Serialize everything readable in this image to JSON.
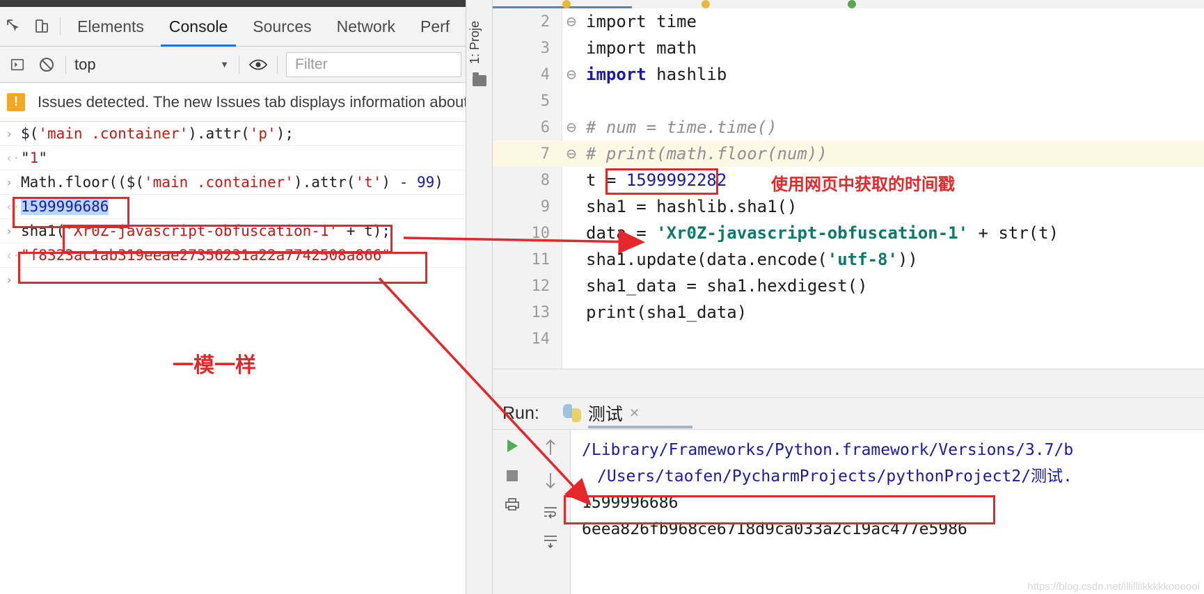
{
  "devtools": {
    "tabs": [
      {
        "label": "Elements",
        "active": false
      },
      {
        "label": "Console",
        "active": true
      },
      {
        "label": "Sources",
        "active": false
      },
      {
        "label": "Network",
        "active": false
      },
      {
        "label": "Perf",
        "active": false
      }
    ],
    "inspect_icon": "inspect-element-icon",
    "device_icon": "device-toolbar-icon",
    "execute_icon": "execute-sidebar-icon",
    "clear_icon": "clear-console-icon",
    "eye_icon": "live-expression-eye-icon",
    "context": "top",
    "caret": "▼",
    "filter_placeholder": "Filter",
    "issues": {
      "badge": "!",
      "text": "Issues detected. The new Issues tab displays information about"
    },
    "entries": [
      {
        "type": "input",
        "prompt": "›",
        "text": "$('main .container').attr('p');"
      },
      {
        "type": "output",
        "prompt": "‹·",
        "text": "\"1\""
      },
      {
        "type": "input",
        "prompt": "›",
        "text": "Math.floor(($('main .container').attr('t') - 99)"
      },
      {
        "type": "output",
        "prompt": "‹·",
        "text": "1599996686"
      },
      {
        "type": "input",
        "prompt": "›",
        "text": "sha1('Xr0Z-javascript-obfuscation-1' + t)"
      },
      {
        "type": "output",
        "prompt": "‹·",
        "text": "\"f8323ac1ab319eeae27356231a22a7742508a866\""
      },
      {
        "type": "input",
        "prompt": "›",
        "text": ""
      }
    ],
    "entry_parts": {
      "line1_a": "$(",
      "line1_b": "'main .container'",
      "line1_c": ").attr(",
      "line1_d": "'p'",
      "line1_e": ");",
      "line2_q1": "\"",
      "line2_v": "1",
      "line2_q2": "\"",
      "line3_a": "Math.floor((",
      "line3_b": "$(",
      "line3_c": "'main .container'",
      "line3_d": ").attr(",
      "line3_e": "'t'",
      "line3_f": ") ",
      "line3_g": "- 99",
      "line3_h": ")",
      "line4_v": "1599996686",
      "line5_a": "sha1(",
      "line5_b": "'Xr0Z-javascript-obfuscation-1'",
      "line5_c": " + t)",
      "line5_d": ";",
      "line6_q1": "\"",
      "line6_v": "f8323ac1ab319eeae27356231a22a7742508a866",
      "line6_q2": "\""
    },
    "annotation": "一模一样"
  },
  "pycharm": {
    "rail_label": "1: Proje",
    "folder_icon": "project-folder-icon",
    "code_lines": [
      {
        "no": "2",
        "fold": "⊖",
        "kw": "import",
        "rest": " time",
        "highlight": false,
        "style": "kw"
      },
      {
        "no": "3",
        "fold": "",
        "kw": "import",
        "rest": " math",
        "highlight": false,
        "style": "plain"
      },
      {
        "no": "4",
        "fold": "⊖",
        "kw": "import",
        "rest": " hashlib",
        "highlight": false,
        "style": "kw"
      },
      {
        "no": "5",
        "fold": "",
        "kw": "",
        "rest": "",
        "highlight": false,
        "style": "plain"
      },
      {
        "no": "6",
        "fold": "⊖",
        "kw": "",
        "rest": "# num = time.time()",
        "highlight": false,
        "style": "comment"
      },
      {
        "no": "7",
        "fold": "⊖",
        "kw": "",
        "rest": "# print(math.floor(num))",
        "highlight": true,
        "style": "comment"
      },
      {
        "no": "8",
        "fold": "",
        "kw": "",
        "rest": "",
        "highlight": false,
        "style": "line8"
      },
      {
        "no": "9",
        "fold": "",
        "kw": "",
        "rest": "sha1 = hashlib.sha1()",
        "highlight": false,
        "style": "plain"
      },
      {
        "no": "10",
        "fold": "",
        "kw": "",
        "rest": "",
        "highlight": false,
        "style": "line10"
      },
      {
        "no": "11",
        "fold": "",
        "kw": "",
        "rest": "",
        "highlight": false,
        "style": "line11"
      },
      {
        "no": "12",
        "fold": "",
        "kw": "",
        "rest": "sha1_data = sha1.hexdigest()",
        "highlight": false,
        "style": "plain"
      },
      {
        "no": "13",
        "fold": "",
        "kw": "",
        "rest": "print(sha1_data)",
        "highlight": false,
        "style": "plain"
      },
      {
        "no": "14",
        "fold": "",
        "kw": "",
        "rest": "",
        "highlight": false,
        "style": "plain"
      }
    ],
    "line8": {
      "var": "t = ",
      "value": "1599992282",
      "note": "使用网页中获取的时间戳"
    },
    "line10": {
      "a": "data = ",
      "str": "'Xr0Z-javascript-obfuscation-1'",
      "b": " + str(t)"
    },
    "line11": {
      "a": "sha1.update(data.encode(",
      "str": "'utf-8'",
      "b": "))"
    },
    "run": {
      "label": "Run:",
      "tab_name": "测试",
      "close": "×",
      "python_icon": "python-logo-icon",
      "run_icon": "run-play-icon",
      "stop_icon": "stop-square-icon",
      "up_icon": "scroll-up-arrow-icon",
      "down_icon": "scroll-down-arrow-icon",
      "print_icon": "print-icon",
      "wrap_icon": "soft-wrap-icon",
      "scrollend_icon": "scroll-to-end-icon",
      "output": [
        {
          "text": "/Library/Frameworks/Python.framework/Versions/3.7/b",
          "indent": false,
          "dark": false
        },
        {
          "text": "/Users/taofen/PycharmProjects/pythonProject2/测试.",
          "indent": true,
          "dark": false
        },
        {
          "text": "1599996686",
          "indent": false,
          "dark": true
        },
        {
          "text": "6eea826fb968ce6718d9ca033a2c19ac477e5986",
          "indent": false,
          "dark": true
        }
      ]
    }
  },
  "watermark": "https://blog.csdn.net/illilliikkkkkoooooi",
  "colors": {
    "accent_blue": "#1a73e8",
    "annotation_red": "#e5262b",
    "string_red": "#c41a16",
    "number_blue": "#1a1aa6",
    "py_string_green": "#0a7a6b",
    "warning_orange": "#f5a623"
  }
}
